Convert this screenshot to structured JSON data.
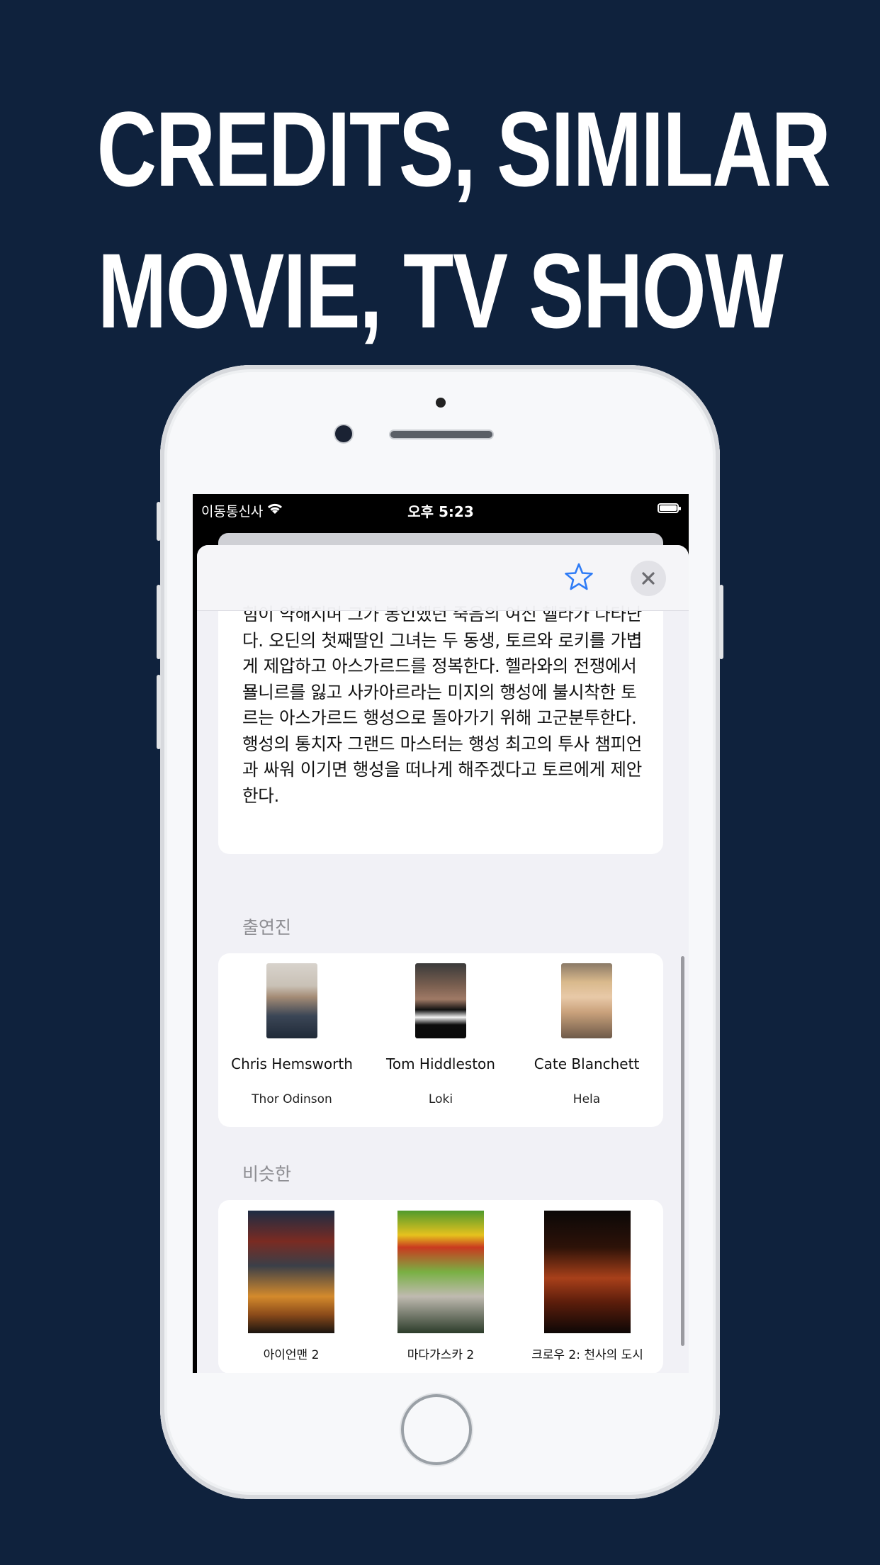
{
  "headline": {
    "line1": "CREDITS, SIMILAR",
    "line2": "MOVIE, TV SHOW"
  },
  "status_bar": {
    "carrier": "이동통신사",
    "time": "오후 5:23"
  },
  "toolbar": {
    "favorite_icon": "star-icon",
    "close_icon": "close-icon"
  },
  "overview": {
    "text": "힘이 약해지며 그가 봉인했던 죽음의 여신 헬라가 나타난다. 오딘의 첫째딸인 그녀는 두 동생, 토르와 로키를 가볍게 제압하고 아스가르드를 정복한다. 헬라와의 전쟁에서 묠니르를 잃고 사카아르라는 미지의 행성에 불시착한 토르는 아스가르드 행성으로 돌아가기 위해 고군분투한다. 행성의 통치자 그랜드 마스터는 행성 최고의 투사 챔피언과 싸워 이기면 행성을 떠나게 해주겠다고 토르에게 제안한다."
  },
  "cast_section": {
    "label": "출연진",
    "people": [
      {
        "name": "Chris Hemsworth",
        "role": "Thor Odinson"
      },
      {
        "name": "Tom Hiddleston",
        "role": "Loki"
      },
      {
        "name": "Cate Blanchett",
        "role": "Hela"
      }
    ]
  },
  "similar_section": {
    "label": "비슷한",
    "movies": [
      {
        "title": "아이언맨 2"
      },
      {
        "title": "마다가스카 2"
      },
      {
        "title": "크로우 2: 천사의 도시"
      }
    ]
  }
}
